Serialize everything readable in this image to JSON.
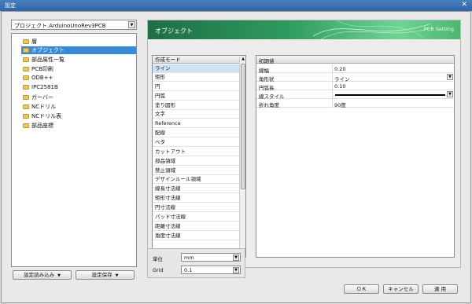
{
  "window": {
    "title": "設定",
    "close_glyph": "✕"
  },
  "project_select": {
    "value": "プロジェクト.ArduinoUnoRev3PCB"
  },
  "tree": [
    {
      "label": "層",
      "selected": false
    },
    {
      "label": "オブジェクト",
      "selected": true
    },
    {
      "label": "部品属性一覧",
      "selected": false
    },
    {
      "label": "PCB印刷",
      "selected": false
    },
    {
      "label": "ODB++",
      "selected": false
    },
    {
      "label": "IPC2581B",
      "selected": false
    },
    {
      "label": "ガーバー",
      "selected": false
    },
    {
      "label": "NCドリル",
      "selected": false
    },
    {
      "label": "NCドリル表",
      "selected": false
    },
    {
      "label": "部品座標",
      "selected": false
    }
  ],
  "left_buttons": {
    "load": "設定読み込み",
    "save": "設定保存"
  },
  "banner": {
    "title": "オブジェクト",
    "subtitle": "PCB Setting"
  },
  "mode_list": {
    "header": "作成モード",
    "items": [
      "ライン",
      "矩形",
      "円",
      "円弧",
      "塗り図形",
      "文字",
      "Reference",
      "配線",
      "ベタ",
      "カットアウト",
      "部品領域",
      "禁止領域",
      "デザインルール領域",
      "線長寸法線",
      "矩形寸法線",
      "円寸法線",
      "パッド寸法線",
      "距離寸法線",
      "角度寸法線"
    ],
    "selected_index": 0
  },
  "properties": {
    "header": "初期値",
    "rows": [
      {
        "key": "線幅",
        "value": "0.20",
        "dropdown": false
      },
      {
        "key": "角形状",
        "value": "ライン",
        "dropdown": true
      },
      {
        "key": "円弧長",
        "value": "0.10",
        "dropdown": false
      },
      {
        "key": "線スタイル",
        "value": "",
        "dropdown": true
      },
      {
        "key": "折れ角度",
        "value": "90度",
        "dropdown": false
      }
    ]
  },
  "unit": {
    "label": "単位",
    "value": "mm"
  },
  "grid": {
    "label": "Grid",
    "value": "0.1"
  },
  "dialog_buttons": {
    "ok": "ＯＫ",
    "cancel": "キャンセル",
    "apply": "適 用"
  },
  "colors": {
    "titlebar": "#3a73b6",
    "banner": "#2f9b5f",
    "selection": "#3a88d8"
  }
}
